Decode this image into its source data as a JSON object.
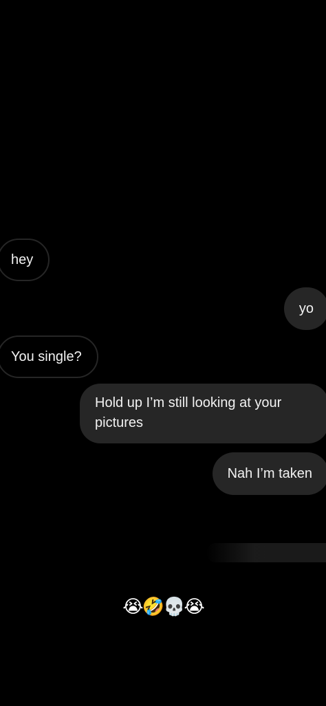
{
  "messages": [
    {
      "id": "m1",
      "sender": "them",
      "text": "hey"
    },
    {
      "id": "m2",
      "sender": "me",
      "text": "yo"
    },
    {
      "id": "m3",
      "sender": "them",
      "text": "You single?"
    },
    {
      "id": "m4",
      "sender": "me",
      "text": "Hold up I’m still looking at your pictures"
    },
    {
      "id": "m5",
      "sender": "me",
      "text": "Nah I’m taken"
    }
  ],
  "caption": "😭🤣💀😭",
  "colors": {
    "background": "#000000",
    "outgoing_bubble": "#262626",
    "incoming_border": "#262626",
    "text": "#f2f2f2"
  }
}
